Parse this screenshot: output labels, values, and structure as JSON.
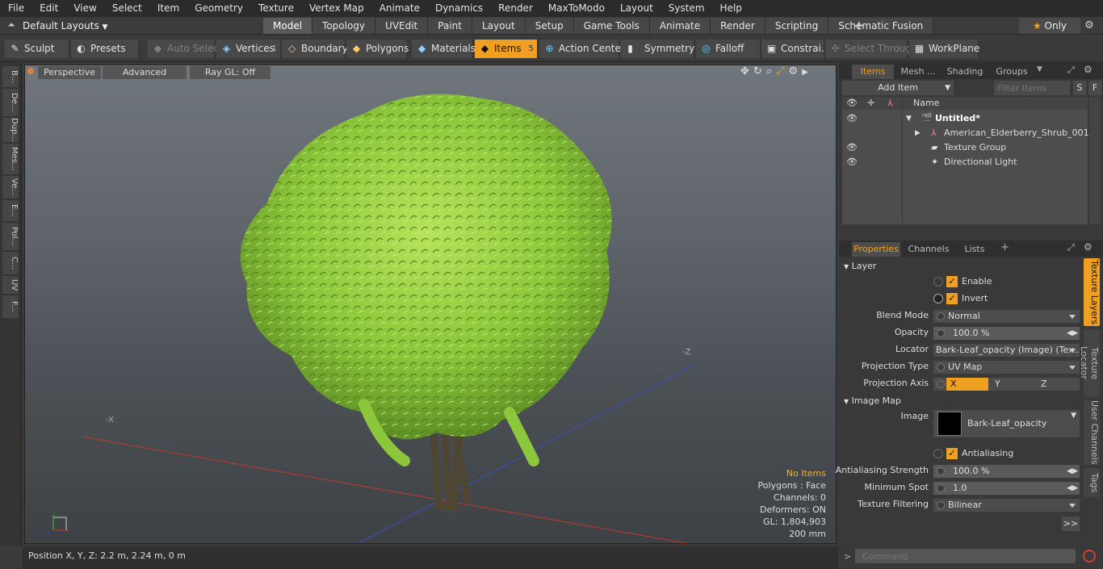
{
  "menu": [
    "File",
    "Edit",
    "View",
    "Select",
    "Item",
    "Geometry",
    "Texture",
    "Vertex Map",
    "Animate",
    "Dynamics",
    "Render",
    "MaxToModo",
    "Layout",
    "System",
    "Help"
  ],
  "layouts_label": "Default Layouts",
  "mode_tabs": [
    "Model",
    "Topology",
    "UVEdit",
    "Paint",
    "Layout",
    "Setup",
    "Game Tools",
    "Animate",
    "Render",
    "Scripting",
    "Schematic Fusion"
  ],
  "active_mode_tab": "Model",
  "only_label": "Only",
  "toolbar": {
    "sculpt": "Sculpt",
    "presets": "Presets",
    "auto_select": "Auto Select",
    "vertices": "Vertices",
    "vertices_count": "1",
    "boundary": "Boundary",
    "polygons": "Polygons",
    "materials": "Materials",
    "items": "Items",
    "items_count": "5",
    "action_center": "Action Center",
    "symmetry": "Symmetry",
    "falloff": "Falloff",
    "constraints": "Constrai...",
    "select_through": "Select Through",
    "workplane": "WorkPlane"
  },
  "left_tabs": [
    "B...",
    "De...",
    "Dup...",
    "Mes...",
    "Ve...",
    "E...",
    "Pol...",
    "C...",
    "UV",
    "F..."
  ],
  "viewport": {
    "perspective": "Perspective",
    "advanced": "Advanced",
    "raygl": "Ray GL: Off",
    "hud": {
      "no_items": "No Items",
      "polygons": "Polygons : Face",
      "channels": "Channels: 0",
      "deformers": "Deformers: ON",
      "gl": "GL: 1,804,903",
      "scale": "200 mm"
    },
    "axis_labels": {
      "z_neg": "-Z",
      "x_neg": "-X"
    }
  },
  "status_bar": "Position X, Y, Z:   2.2 m, 2.24 m, 0 m",
  "items_panel": {
    "tabs": [
      "Items",
      "Mesh ...",
      "Shading",
      "Groups"
    ],
    "add_item": "Add Item",
    "filter_placeholder": "Filter Items",
    "s_btn": "S",
    "f_btn": "F",
    "name_col": "Name",
    "tree": [
      {
        "label": "Untitled*",
        "visible": true
      },
      {
        "label": "American_Elderberry_Shrub_001",
        "visible": false
      },
      {
        "label": "Texture Group",
        "visible": true
      },
      {
        "label": "Directional Light",
        "visible": true
      }
    ]
  },
  "properties_panel": {
    "tabs": [
      "Properties",
      "Channels",
      "Lists"
    ],
    "layer_section": "Layer",
    "enable": "Enable",
    "invert": "Invert",
    "blend_mode_label": "Blend Mode",
    "blend_mode": "Normal",
    "opacity_label": "Opacity",
    "opacity": "100.0 %",
    "locator_label": "Locator",
    "locator": "Bark-Leaf_opacity (Image) (Tex...",
    "projection_type_label": "Projection Type",
    "projection_type": "UV Map",
    "projection_axis_label": "Projection Axis",
    "axis_x": "X",
    "axis_y": "Y",
    "axis_z": "Z",
    "image_map_section": "Image Map",
    "image_label": "Image",
    "image_name": "Bark-Leaf_opacity",
    "antialiasing": "Antialiasing",
    "aa_strength_label": "Antialiasing Strength",
    "aa_strength": "100.0 %",
    "min_spot_label": "Minimum Spot",
    "min_spot": "1.0",
    "tex_filter_label": "Texture Filtering",
    "tex_filter": "Bilinear",
    "more_btn": ">>",
    "side_tabs": [
      "Texture Layers",
      "Texture Locator",
      "User Channels",
      "Tags"
    ]
  },
  "command_placeholder": "Command",
  "colors": {
    "accent": "#f0a020",
    "leaf": "#8cc63a"
  }
}
